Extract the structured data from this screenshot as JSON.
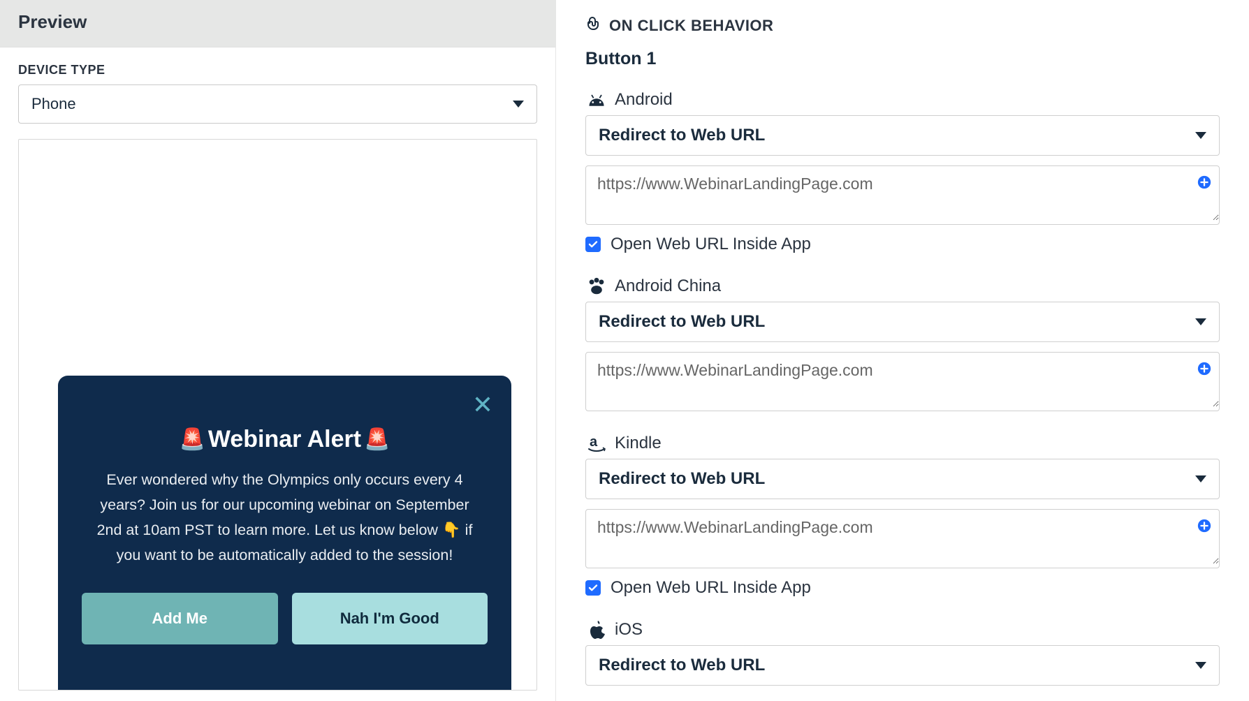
{
  "left": {
    "preview_title": "Preview",
    "device_type": {
      "label": "DEVICE TYPE",
      "value": "Phone"
    },
    "modal": {
      "title": "Webinar Alert",
      "body": "Ever wondered why the Olympics only occurs every 4 years? Join us for our upcoming webinar on September 2nd at 10am PST to learn more. Let us know below 👇 if you want to be automatically added to the session!",
      "primary": "Add Me",
      "secondary": "Nah I'm Good"
    }
  },
  "right": {
    "section_label": "ON CLICK BEHAVIOR",
    "button_name": "Button 1",
    "platforms": {
      "android": {
        "label": "Android",
        "action": "Redirect to Web URL",
        "url": "https://www.WebinarLandingPage.com",
        "open_inside_label": "Open Web URL Inside App",
        "open_inside_checked": true
      },
      "android_china": {
        "label": "Android China",
        "action": "Redirect to Web URL",
        "url": "https://www.WebinarLandingPage.com"
      },
      "kindle": {
        "label": "Kindle",
        "action": "Redirect to Web URL",
        "url": "https://www.WebinarLandingPage.com",
        "open_inside_label": "Open Web URL Inside App",
        "open_inside_checked": true
      },
      "ios": {
        "label": "iOS",
        "action": "Redirect to Web URL"
      }
    }
  }
}
